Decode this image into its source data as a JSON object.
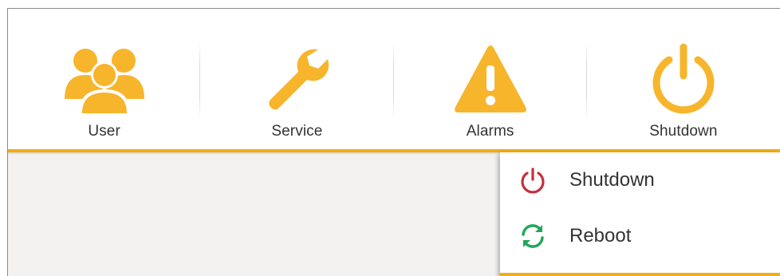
{
  "colors": {
    "accent": "#f0ad15",
    "icon_orange": "#f7b52c",
    "shutdown_red": "#c62f3a",
    "reboot_green": "#21a65a"
  },
  "toolbar": {
    "items": [
      {
        "label": "User",
        "icon": "users-icon"
      },
      {
        "label": "Service",
        "icon": "wrench-icon"
      },
      {
        "label": "Alarms",
        "icon": "warning-icon"
      },
      {
        "label": "Shutdown",
        "icon": "power-icon"
      }
    ]
  },
  "menu": {
    "items": [
      {
        "label": "Shutdown",
        "icon": "power-icon"
      },
      {
        "label": "Reboot",
        "icon": "refresh-icon"
      }
    ]
  }
}
